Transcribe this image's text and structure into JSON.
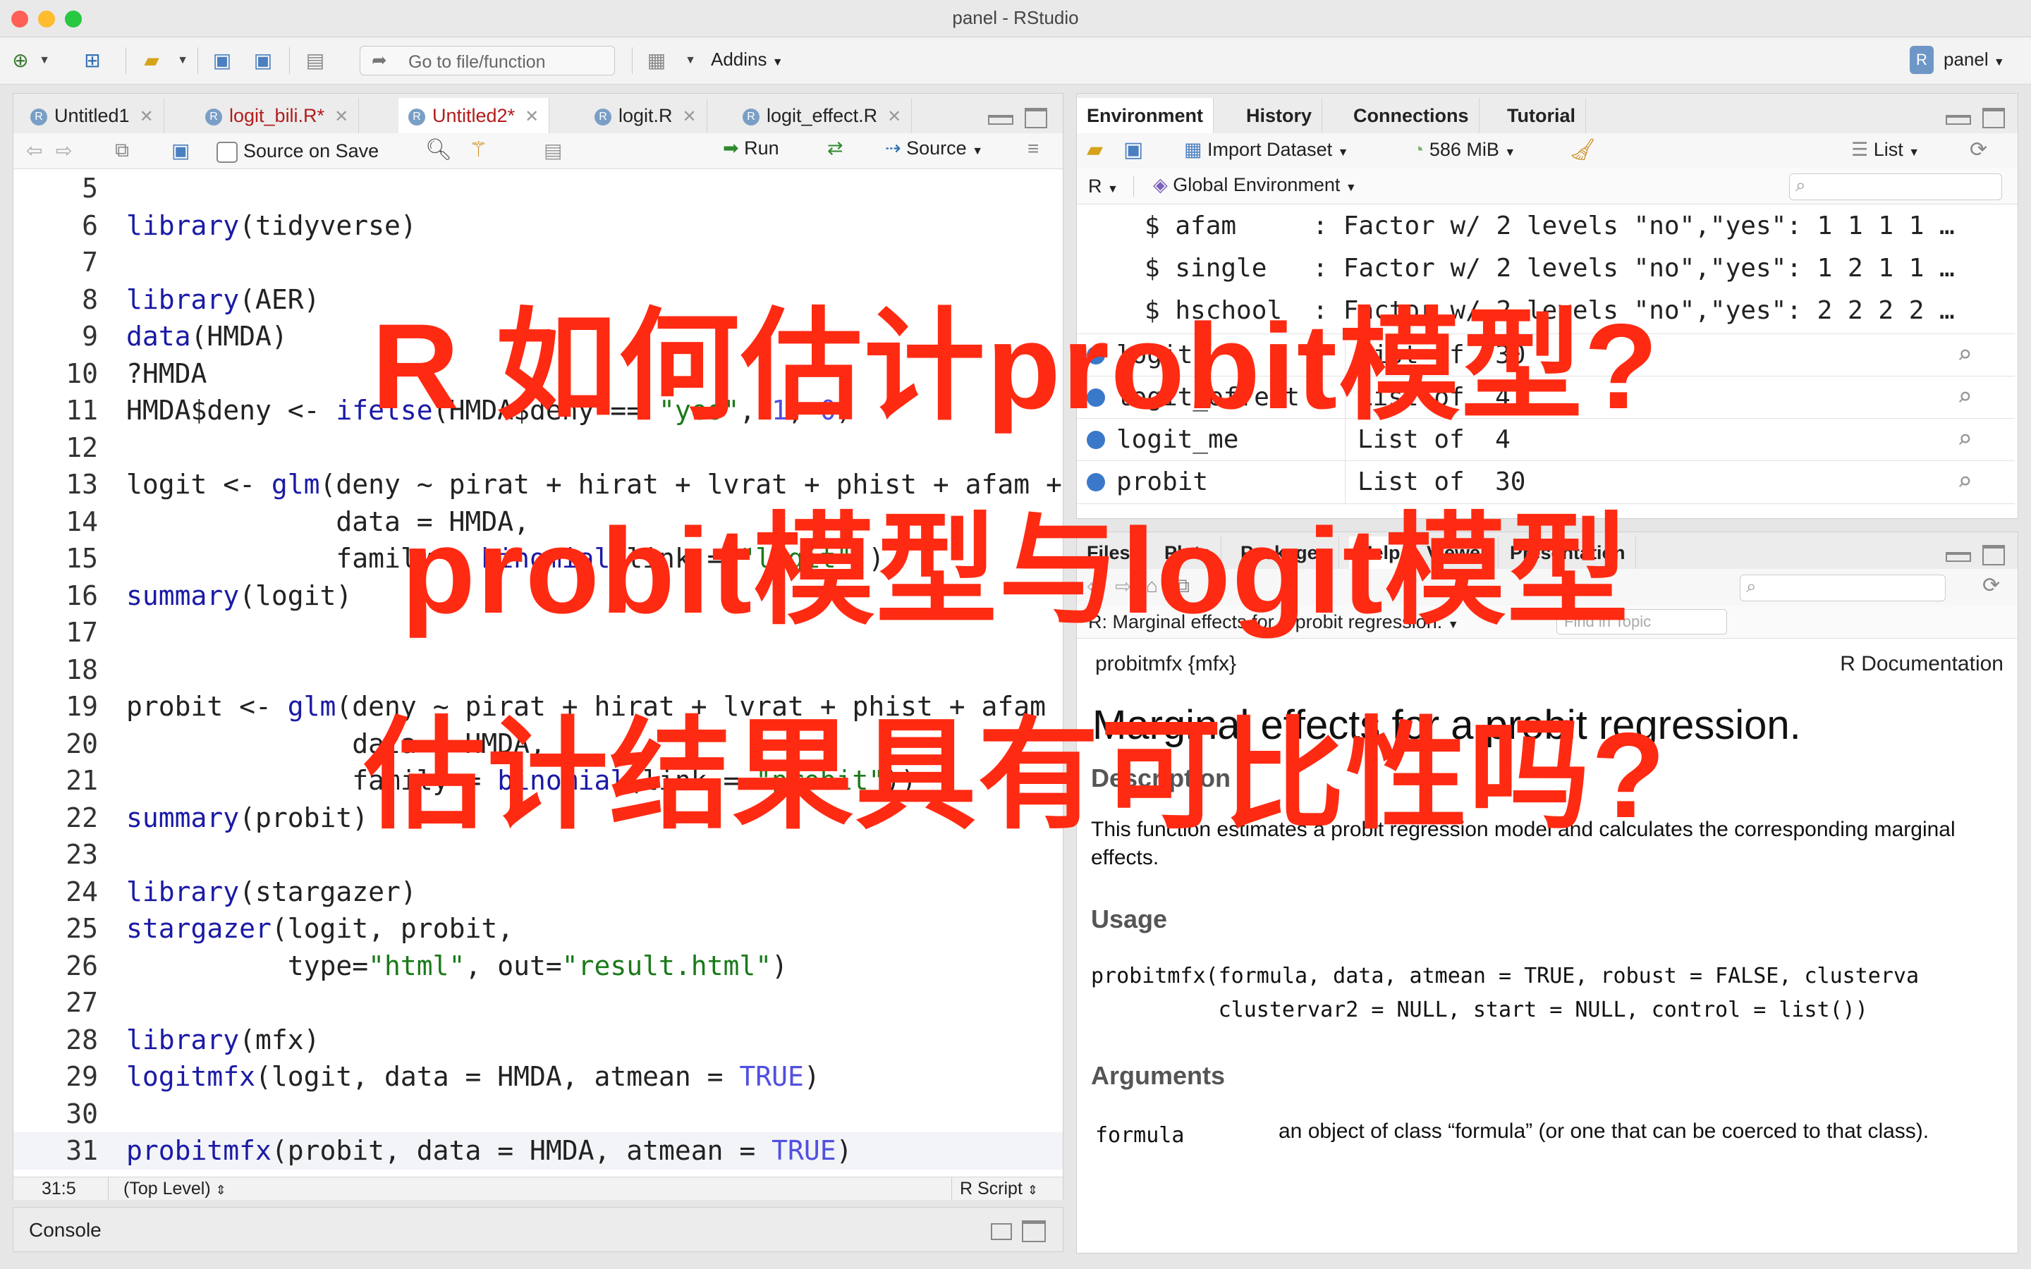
{
  "window": {
    "title": "panel - RStudio"
  },
  "toolbar": {
    "goto_placeholder": "Go to file/function",
    "addins": "Addins",
    "project": "panel"
  },
  "editor": {
    "tabs": [
      {
        "label": "Untitled1",
        "modified": false
      },
      {
        "label": "logit_bili.R*",
        "modified": true
      },
      {
        "label": "Untitled2*",
        "modified": true,
        "active": true
      },
      {
        "label": "logit.R",
        "modified": false
      },
      {
        "label": "logit_effect.R",
        "modified": false
      }
    ],
    "source_on_save": "Source on Save",
    "run": "Run",
    "source": "Source",
    "lines": [
      {
        "n": "5",
        "t": ""
      },
      {
        "n": "6",
        "t": "library(tidyverse)"
      },
      {
        "n": "7",
        "t": ""
      },
      {
        "n": "8",
        "t": "library(AER)"
      },
      {
        "n": "9",
        "t": "data(HMDA)"
      },
      {
        "n": "10",
        "t": "?HMDA"
      },
      {
        "n": "11",
        "t": "HMDA$deny <- ifelse(HMDA$deny == \"yes\", 1, 0)"
      },
      {
        "n": "12",
        "t": ""
      },
      {
        "n": "13",
        "t": "logit <- glm(deny ~ pirat + hirat + lvrat + phist + afam + si"
      },
      {
        "n": "14",
        "t": "             data = HMDA,"
      },
      {
        "n": "15",
        "t": "             family = binomial(link = \"logit\"))"
      },
      {
        "n": "16",
        "t": "summary(logit)"
      },
      {
        "n": "17",
        "t": ""
      },
      {
        "n": "18",
        "t": ""
      },
      {
        "n": "19",
        "t": "probit <- glm(deny ~ pirat + hirat + lvrat + phist + afam + s"
      },
      {
        "n": "20",
        "t": "              data = HMDA,"
      },
      {
        "n": "21",
        "t": "              family = binomial(link = \"probit\"))"
      },
      {
        "n": "22",
        "t": "summary(probit)"
      },
      {
        "n": "23",
        "t": ""
      },
      {
        "n": "24",
        "t": "library(stargazer)"
      },
      {
        "n": "25",
        "t": "stargazer(logit, probit,"
      },
      {
        "n": "26",
        "t": "          type=\"html\", out=\"result.html\")"
      },
      {
        "n": "27",
        "t": ""
      },
      {
        "n": "28",
        "t": "library(mfx)"
      },
      {
        "n": "29",
        "t": "logitmfx(logit, data = HMDA, atmean = TRUE)"
      },
      {
        "n": "30",
        "t": ""
      },
      {
        "n": "31",
        "t": "probitmfx(probit, data = HMDA, atmean = TRUE)"
      }
    ],
    "status_pos": "31:5",
    "status_scope": "(Top Level)",
    "status_type": "R Script"
  },
  "console": {
    "label": "Console"
  },
  "env": {
    "tabs": [
      "Environment",
      "History",
      "Connections",
      "Tutorial"
    ],
    "import": "Import Dataset",
    "memory": "586 MiB",
    "view": "List",
    "lang": "R",
    "scope": "Global Environment",
    "struct_rows": [
      "$ afam     : Factor w/ 2 levels \"no\",\"yes\": 1 1 1 1 …",
      "$ single   : Factor w/ 2 levels \"no\",\"yes\": 1 2 1 1 …",
      "$ hschool  : Factor w/ 2 levels \"no\",\"yes\": 2 2 2 2 …"
    ],
    "objects": [
      {
        "name": "logit",
        "value": "List of  30"
      },
      {
        "name": "logit_effect",
        "value": "List of  4"
      },
      {
        "name": "logit_me",
        "value": "List of  4"
      },
      {
        "name": "probit",
        "value": "List of  30"
      }
    ]
  },
  "help": {
    "tabs": [
      "Files",
      "Plots",
      "Packages",
      "Help",
      "Viewer",
      "Presentation"
    ],
    "crumb": "R: Marginal effects for a probit regression.",
    "find_placeholder": "Find in Topic",
    "topic": "probitmfx {mfx}",
    "rdoc": "R Documentation",
    "title": "Marginal effects for a probit regression.",
    "desc_h": "Description",
    "desc": "This function estimates a probit regression model and calculates the corresponding marginal effects.",
    "usage_h": "Usage",
    "usage1": "probitmfx(formula, data, atmean = TRUE, robust = FALSE, clusterva",
    "usage2": "          clustervar2 = NULL, start = NULL, control = list())",
    "args_h": "Arguments",
    "arg_name": "formula",
    "arg_desc": "an object of class “formula” (or one that can be coerced to that class)."
  },
  "overlay": {
    "line1": "R 如何估计probit模型?",
    "line2": "probit模型与logit模型",
    "line3": "估计结果具有可比性吗?"
  }
}
